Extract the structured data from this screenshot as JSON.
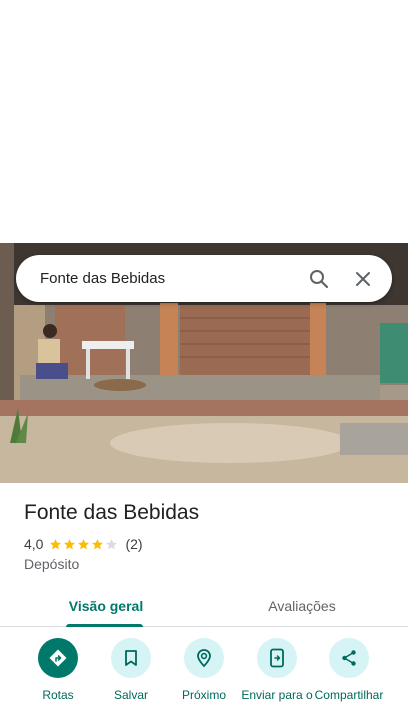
{
  "search": {
    "query": "Fonte das Bebidas",
    "search_icon": "search-icon",
    "close_icon": "close-icon"
  },
  "place": {
    "name": "Fonte das Bebidas",
    "rating": "4,0",
    "rating_stars": 4,
    "reviews": "(2)",
    "category": "Depósito"
  },
  "tabs": [
    {
      "label": "Visão geral",
      "active": true
    },
    {
      "label": "Avaliações",
      "active": false
    }
  ],
  "actions": [
    {
      "label": "Rotas",
      "icon": "directions-icon"
    },
    {
      "label": "Salvar",
      "icon": "bookmark-icon"
    },
    {
      "label": "Próximo",
      "icon": "nearby-icon"
    },
    {
      "label": "Enviar para o",
      "icon": "send-to-phone-icon"
    },
    {
      "label": "Compartilhar",
      "icon": "share-icon"
    }
  ],
  "colors": {
    "accent": "#00796b",
    "action_bg": "#d6f3f5",
    "star": "#fbbc04"
  }
}
